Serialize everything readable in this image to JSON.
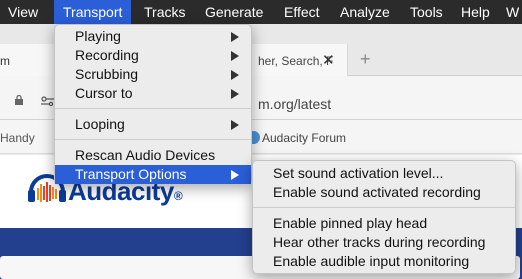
{
  "menubar": {
    "items": [
      {
        "label": "View"
      },
      {
        "label": "Transport"
      },
      {
        "label": "Tracks"
      },
      {
        "label": "Generate"
      },
      {
        "label": "Effect"
      },
      {
        "label": "Analyze"
      },
      {
        "label": "Tools"
      },
      {
        "label": "Help"
      },
      {
        "label": "W"
      }
    ]
  },
  "browser": {
    "tab_left_text": "m",
    "tab_right_text": "her, Search, F",
    "url_text": "m.org/latest",
    "bookmark_left": "Handy",
    "bookmark_forum": "Audacity Forum"
  },
  "page": {
    "logo_text": "Audacity",
    "logo_mark": "®"
  },
  "transport_menu": {
    "items": [
      {
        "label": "Playing",
        "submenu": true
      },
      {
        "label": "Recording",
        "submenu": true
      },
      {
        "label": "Scrubbing",
        "submenu": true
      },
      {
        "label": "Cursor to",
        "submenu": true
      },
      {
        "label": "Looping",
        "submenu": true
      },
      {
        "label": "Rescan Audio Devices",
        "submenu": false
      },
      {
        "label": "Transport Options",
        "submenu": true,
        "highlighted": true
      }
    ]
  },
  "transport_options_menu": {
    "items": [
      {
        "label": "Set sound activation level..."
      },
      {
        "label": "Enable sound activated recording"
      },
      {
        "label": "Enable pinned play head"
      },
      {
        "label": "Hear other tracks during recording"
      },
      {
        "label": "Enable audible input monitoring"
      }
    ]
  },
  "colors": {
    "highlight": "#2a5fd8",
    "menubar_bg": "#2b2b2b",
    "brand_blue": "#0c3c98"
  }
}
